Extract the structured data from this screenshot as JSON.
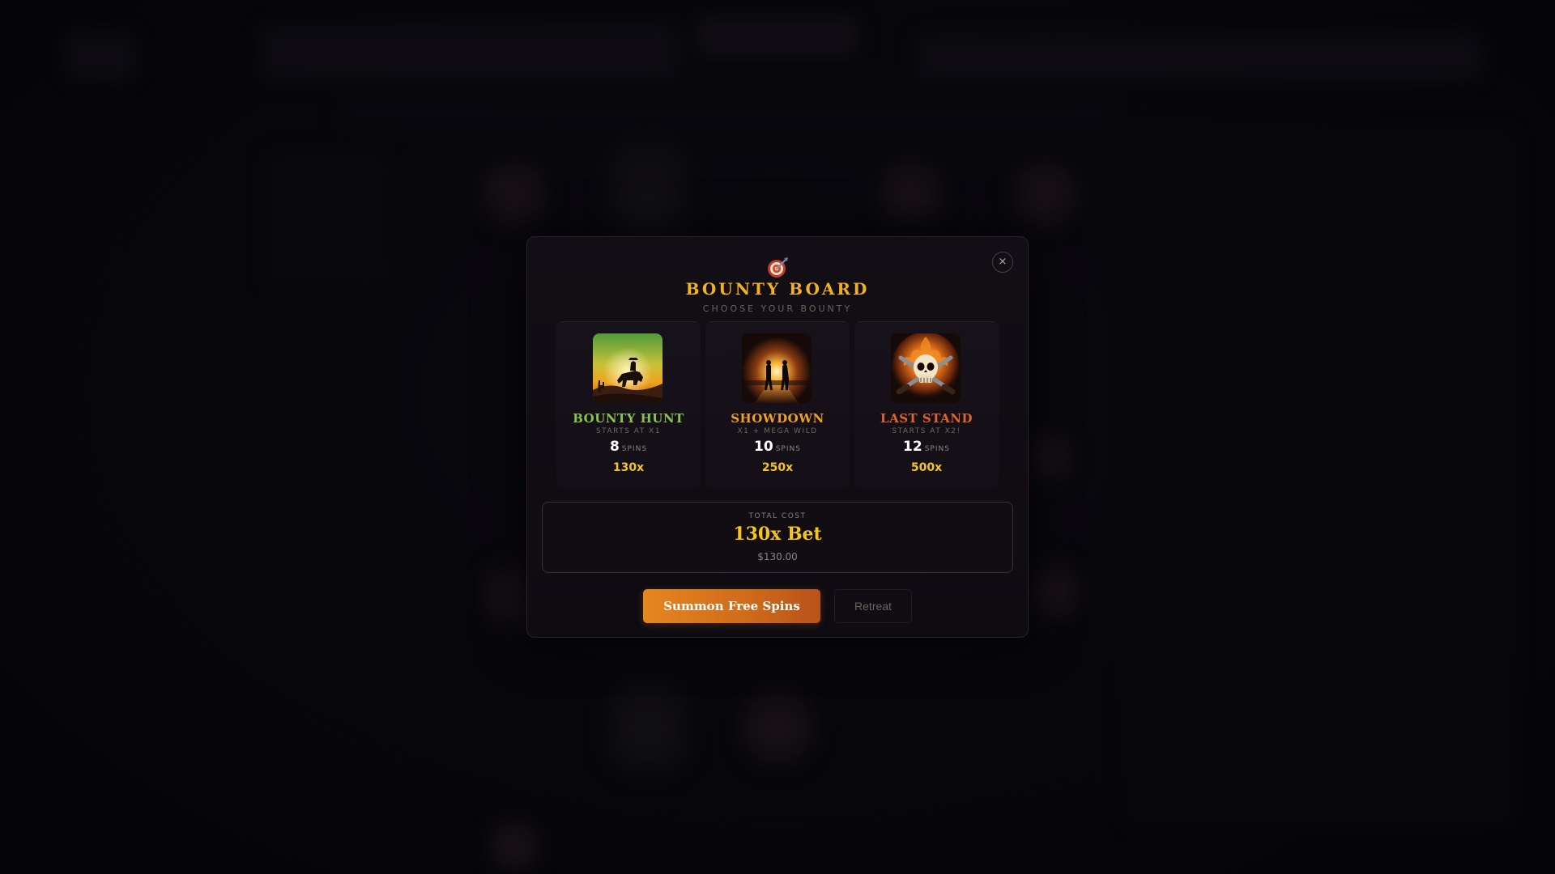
{
  "modal": {
    "icon": "target-dart-icon",
    "title": "BOUNTY BOARD",
    "subtitle": "CHOOSE YOUR BOUNTY",
    "close_label": "×"
  },
  "bounties": [
    {
      "name": "BOUNTY HUNT",
      "subtitle": "STARTS AT X1",
      "spins": "8",
      "spins_label": "SPINS",
      "multiplier": "130x",
      "name_color": "#8bc34a",
      "art": "cowboy-sunset-art"
    },
    {
      "name": "SHOWDOWN",
      "subtitle": "X1 + MEGA WILD",
      "spins": "10",
      "spins_label": "SPINS",
      "multiplier": "250x",
      "name_color": "#f0a020",
      "art": "duel-showdown-art"
    },
    {
      "name": "LAST STAND",
      "subtitle": "STARTS AT X2!",
      "spins": "12",
      "spins_label": "SPINS",
      "multiplier": "500x",
      "name_color": "#e0642a",
      "art": "flaming-skull-art"
    }
  ],
  "cost": {
    "label": "TOTAL COST",
    "value": "130x Bet",
    "money": "$130.00"
  },
  "buttons": {
    "summon": "Summon Free Spins",
    "retreat": "Retreat"
  },
  "colors": {
    "accent_gold": "#f2b21f",
    "button_orange": "#e6861f"
  }
}
